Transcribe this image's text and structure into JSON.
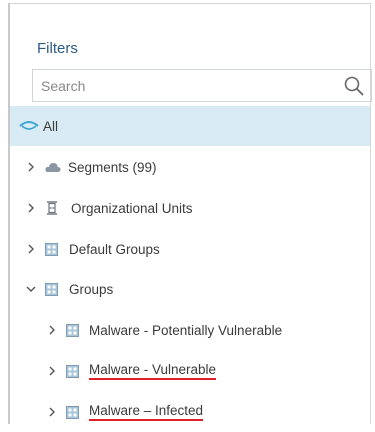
{
  "filters": {
    "title": "Filters",
    "search_placeholder": "Search"
  },
  "tree": {
    "all": "All",
    "segments": "Segments (99)",
    "org_units": "Organizational Units",
    "default_groups": "Default Groups",
    "groups": "Groups",
    "children": [
      "Malware - Potentially Vulnerable",
      "Malware - Vulnerable",
      "Malware – Infected"
    ]
  },
  "colors": {
    "title": "#2c5b82",
    "selected_row": "#d8eaf3",
    "accent": "#3fa7d6",
    "underline": "#e0202a"
  }
}
